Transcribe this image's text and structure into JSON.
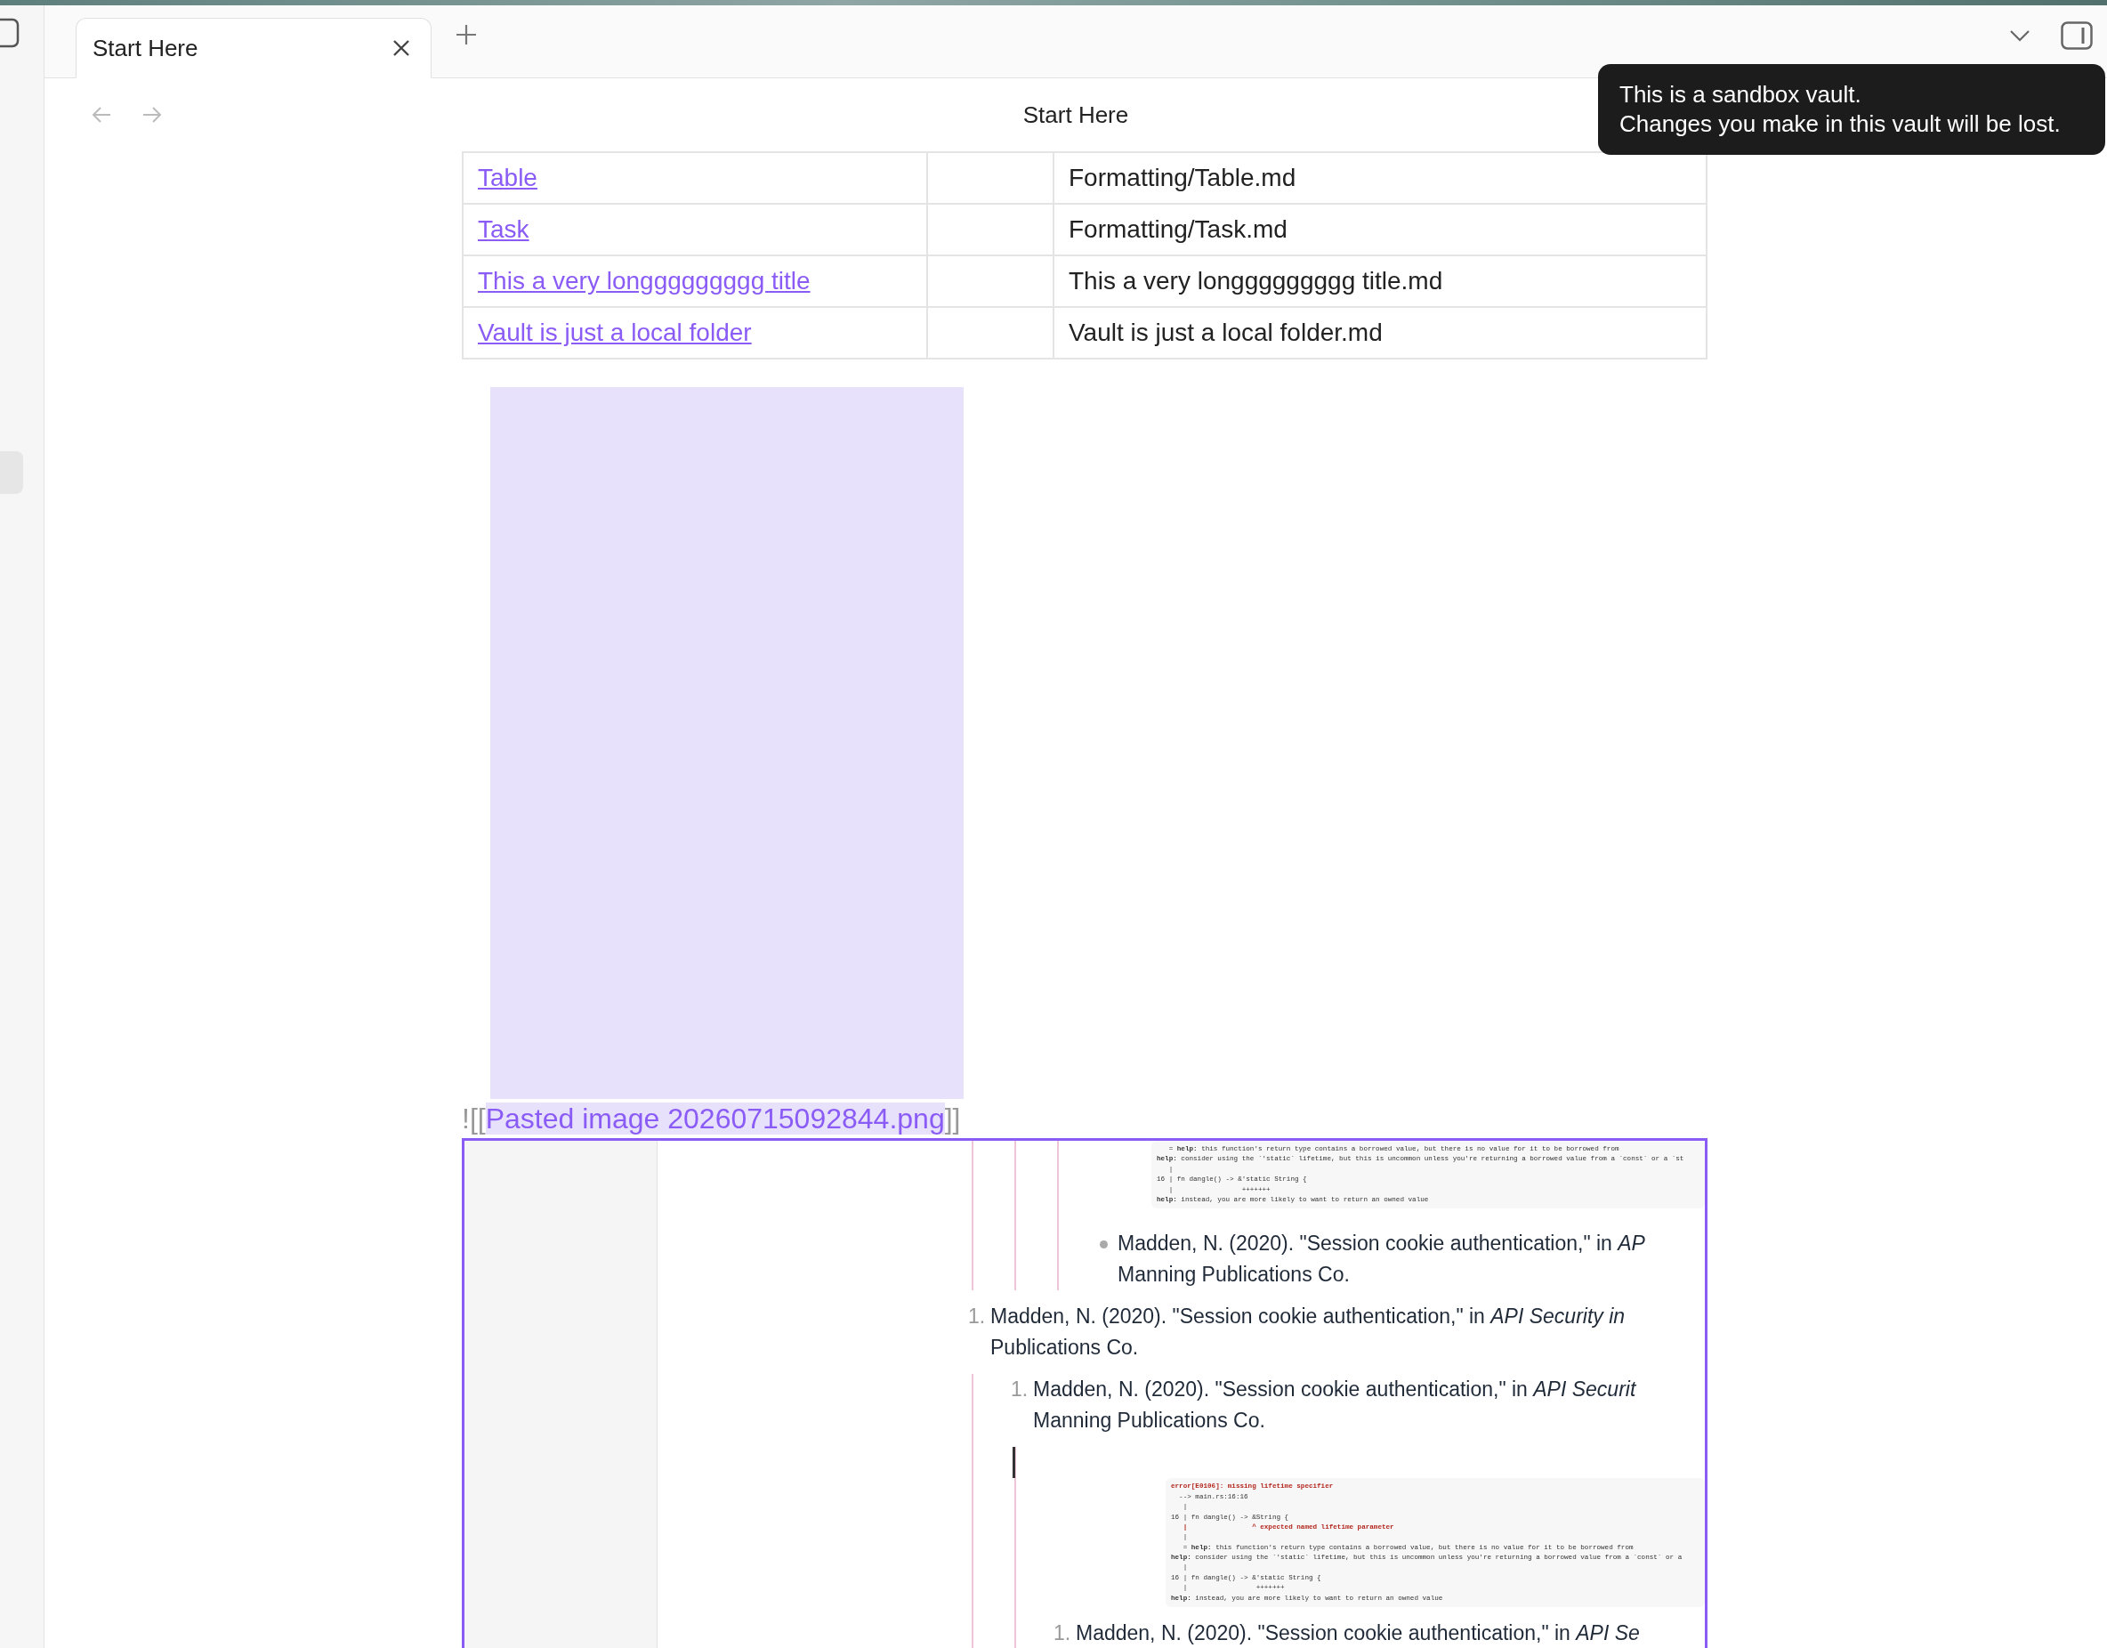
{
  "tab_bar": {
    "tabs": [
      {
        "label": "Start Here",
        "selected": true
      }
    ]
  },
  "nav_bar": {
    "title": "Start Here"
  },
  "tooltip": {
    "lines": [
      "This is a sandbox vault.",
      "Changes you make in this vault will be lost."
    ]
  },
  "table": {
    "rows": [
      {
        "link": "Table",
        "path": "Formatting/Table.md"
      },
      {
        "link": "Task",
        "path": "Formatting/Task.md"
      },
      {
        "link": "This a very longgggggggg title",
        "path": "This a very longgggggggg title.md"
      },
      {
        "link": "Vault is just a local folder",
        "path": "Vault is just a local folder.md"
      }
    ]
  },
  "embed": {
    "prefix": "![[",
    "link": "Pasted image 20260715092844.png",
    "suffix": "]]",
    "selected": true
  },
  "embedded_screenshot": {
    "blocks": [
      {
        "kind": "continuation",
        "children": [
          {
            "kind": "continuation",
            "children": [
              {
                "kind": "continuation",
                "children": [
                  {
                    "kind": "code",
                    "lines": [
                      {
                        "kind": "plain",
                        "text": "   = **help:** this function's return type contains a borrowed value, but there is no value for it to be borrowed from"
                      },
                      {
                        "kind": "plain",
                        "text": "**help:** consider using the `'static` lifetime, but this is uncommon unless you're returning a borrowed value from a `const` or a `st"
                      },
                      {
                        "kind": "plain",
                        "text": "   |"
                      },
                      {
                        "kind": "plain",
                        "text": "16 | fn dangle() -> &'static String {"
                      },
                      {
                        "kind": "plain",
                        "text": "   |                 +++++++"
                      },
                      {
                        "kind": "plain",
                        "text": "**help:** instead, you are more likely to want to return an owned value"
                      }
                    ]
                  },
                  {
                    "kind": "bullet",
                    "lines": [
                      "Madden, N. (2020). \"Session cookie authentication,\" in *AP*",
                      "Manning Publications Co."
                    ]
                  }
                ]
              }
            ]
          }
        ]
      },
      {
        "kind": "numbered",
        "marker": "1.",
        "lines": [
          "Madden, N. (2020). \"Session cookie authentication,\" in *API Security in*",
          "Publications Co."
        ],
        "children": [
          {
            "kind": "numbered",
            "marker": "1.",
            "lines": [
              "Madden, N. (2020). \"Session cookie authentication,\" in *API Securit*",
              "Manning Publications Co."
            ],
            "children": [
              {
                "kind": "cursor"
              },
              {
                "kind": "code",
                "lines": [
                  {
                    "kind": "error",
                    "text": "error[E0106]: missing lifetime specifier"
                  },
                  {
                    "kind": "plain",
                    "text": "  --> main.rs:16:16"
                  },
                  {
                    "kind": "plain",
                    "text": "   |"
                  },
                  {
                    "kind": "plain",
                    "text": "16 | fn dangle() -> &String {"
                  },
                  {
                    "kind": "error",
                    "text": "   |                ^ expected named lifetime parameter"
                  },
                  {
                    "kind": "plain",
                    "text": "   |"
                  },
                  {
                    "kind": "plain",
                    "text": "   = **help:** this function's return type contains a borrowed value, but there is no value for it to be borrowed from"
                  },
                  {
                    "kind": "plain",
                    "text": "**help:** consider using the `'static` lifetime, but this is uncommon unless you're returning a borrowed value from a `const` or a"
                  },
                  {
                    "kind": "plain",
                    "text": "   |"
                  },
                  {
                    "kind": "plain",
                    "text": "16 | fn dangle() -> &'static String {"
                  },
                  {
                    "kind": "plain",
                    "text": "   |                 +++++++"
                  },
                  {
                    "kind": "plain",
                    "text": "**help:** instead, you are more likely to want to return an owned value"
                  }
                ]
              },
              {
                "kind": "numbered",
                "marker": "1.",
                "lines": [
                  "Madden, N. (2020). \"Session cookie authentication,\" in *API Se*"
                ]
              }
            ]
          }
        ]
      }
    ]
  }
}
